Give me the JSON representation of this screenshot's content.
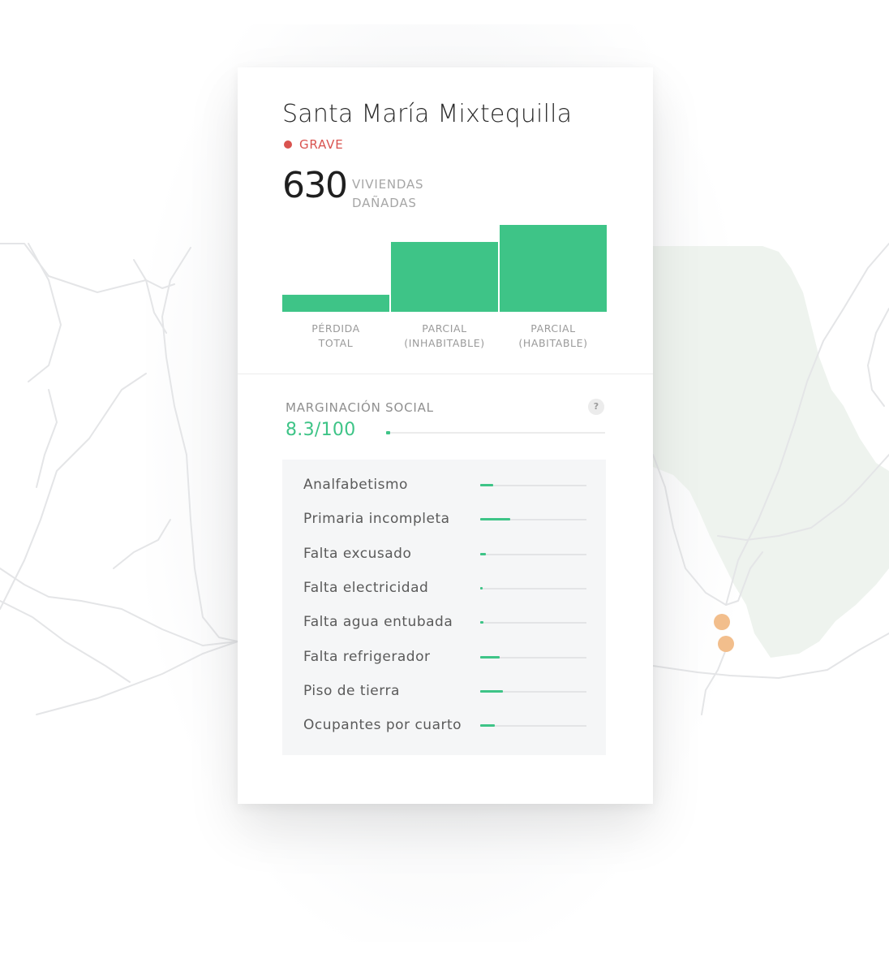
{
  "map": {
    "marker_color": "#f2be8c",
    "region_color": "#eef3ee",
    "road_color": "#e4e5e7"
  },
  "card": {
    "title": "Santa María Mixtequilla",
    "severity": {
      "label": "GRAVE",
      "color": "#d9534f"
    },
    "damage_count": "630",
    "damage_label_line1": "VIVIENDAS",
    "damage_label_line2": "DAÑADAS"
  },
  "chart_data": {
    "type": "bar",
    "categories": [
      "PÉRDIDA TOTAL",
      "PARCIAL (INHABITABLE)",
      "PARCIAL (HABITABLE)"
    ],
    "category_lines": [
      [
        "PÉRDIDA",
        "TOTAL"
      ],
      [
        "PARCIAL",
        "(INHABITABLE)"
      ],
      [
        "PARCIAL",
        "(HABITABLE)"
      ]
    ],
    "values": [
      20,
      82,
      102
    ],
    "ylim": [
      0,
      102
    ],
    "bar_color": "#3ec487",
    "grid": false,
    "title": "",
    "xlabel": "",
    "ylabel": ""
  },
  "marginacion": {
    "title": "MARGINACIÓN SOCIAL",
    "help_icon": "?",
    "score_text": "8.3/100",
    "score_value": 8.3,
    "score_max": 100,
    "accent_color": "#3ec487",
    "indicators": [
      {
        "label": "Analfabetismo",
        "value": 0.12
      },
      {
        "label": "Primaria incompleta",
        "value": 0.28
      },
      {
        "label": "Falta excusado",
        "value": 0.05
      },
      {
        "label": "Falta electricidad",
        "value": 0.02
      },
      {
        "label": "Falta agua entubada",
        "value": 0.03
      },
      {
        "label": "Falta refrigerador",
        "value": 0.18
      },
      {
        "label": "Piso de tierra",
        "value": 0.21
      },
      {
        "label": "Ocupantes por cuarto",
        "value": 0.14
      }
    ]
  }
}
